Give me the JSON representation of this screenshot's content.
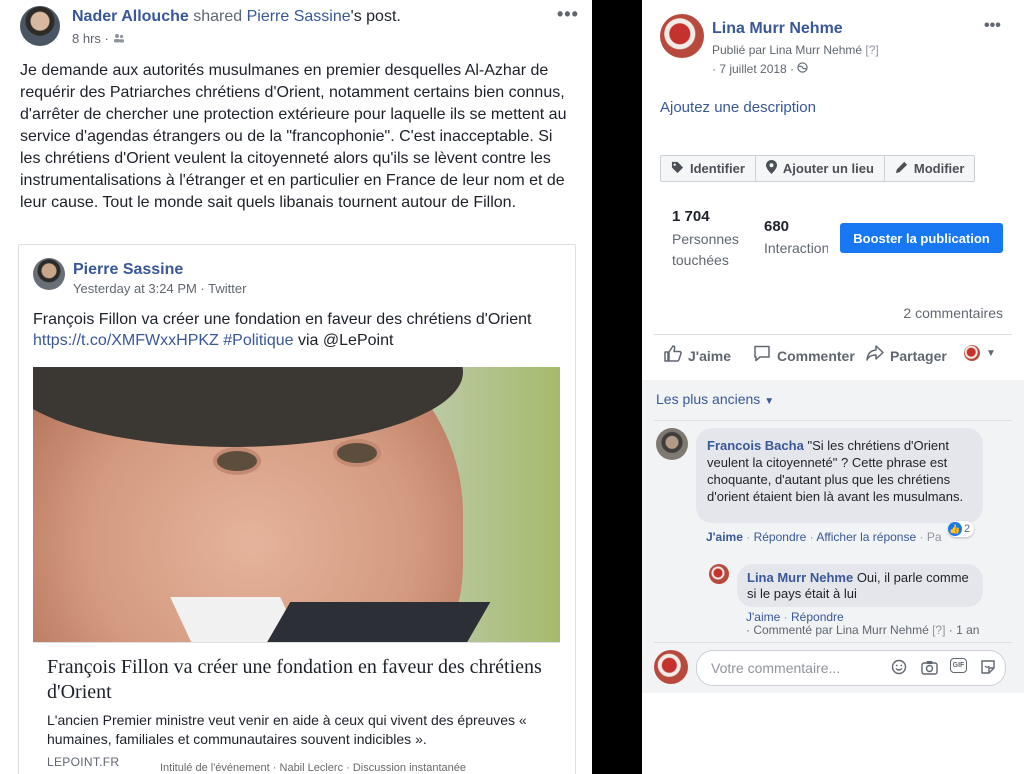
{
  "left_post": {
    "author": "Nader Allouche",
    "shared_word": "shared",
    "shared_from": "Pierre Sassine",
    "shared_suffix": "'s post.",
    "time": "8 hrs",
    "privacy_icon": "friends-icon",
    "more_icon": "•••",
    "body": "Je demande aux autorités musulmanes en premier desquelles Al-Azhar de requérir des Patriarches chrétiens d'Orient, notamment certains bien connus, d'arrêter de chercher une protection extérieure pour laquelle ils se mettent au service d'agendas étrangers ou de la \"francophonie\". C'est inacceptable. Si les chrétiens d'Orient veulent la citoyenneté alors qu'ils se lèvent contre les instrumentalisations à l'étranger et en particulier en France de leur nom et de leur cause. Tout le monde sait quels libanais tournent autour de Fillon.",
    "card": {
      "author": "Pierre Sassine",
      "meta": "Yesterday at 3:24 PM · Twitter",
      "text": "François Fillon va créer une fondation en faveur des chrétiens d'Orient",
      "link": "https://t.co/XMFWxxHPKZ",
      "hashtag": "#Politique",
      "via": "via @LePoint",
      "article_title": "François Fillon va créer une fondation en faveur des chrétiens d'Orient",
      "article_desc": "L'ancien Premier ministre veut venir en aide à ceux qui vivent des épreuves « humaines, familiales et communautaires souvent indicibles ».",
      "source": "LEPOINT.FR"
    }
  },
  "right_panel": {
    "author": "Lina Murr Nehme",
    "published_by": "Publié par Lina Murr Nehmé",
    "q_mark": "[?]",
    "date": "· 7 juillet 2018 ·",
    "globe_icon": "globe-icon",
    "more_icon": "•••",
    "add_description": "Ajoutez une description",
    "toolbar": {
      "identify": "Identifier",
      "add_place": "Ajouter un lieu",
      "edit": "Modifier"
    },
    "stats": {
      "reached_value": "1 704",
      "reached_label": "Personnes touchées",
      "interactions_value": "680",
      "interactions_label": "Interactions"
    },
    "boost_label": "Booster la publication",
    "comment_count": "2 commentaires",
    "actions": {
      "like": "J'aime",
      "comment": "Commenter",
      "share": "Partager"
    },
    "sort_label": "Les plus anciens",
    "comments": [
      {
        "author": "Francois Bacha",
        "text": "\"Si les chrétiens d'Orient veulent la citoyenneté\" ? Cette phrase est choquante, d'autant plus que les chrétiens d'orient étaient bien là avant les musulmans.",
        "reaction_count": "2",
        "like": "J'aime",
        "reply": "Répondre",
        "hide": "Afficher la réponse",
        "hide_trunc": "· Pa"
      },
      {
        "author": "Lina Murr Nehme",
        "text": "Oui, il parle comme si le pays était à lui",
        "like": "J'aime",
        "reply": "Répondre",
        "commented_by": "Commenté par Lina Murr Nehmé",
        "q_mark": "[?]",
        "age": "· 1 an"
      }
    ],
    "composer_placeholder": "Votre commentaire..."
  },
  "background_strip": "Intitulé de l'événement · Nabil Leclerc · Discussion instantanée"
}
